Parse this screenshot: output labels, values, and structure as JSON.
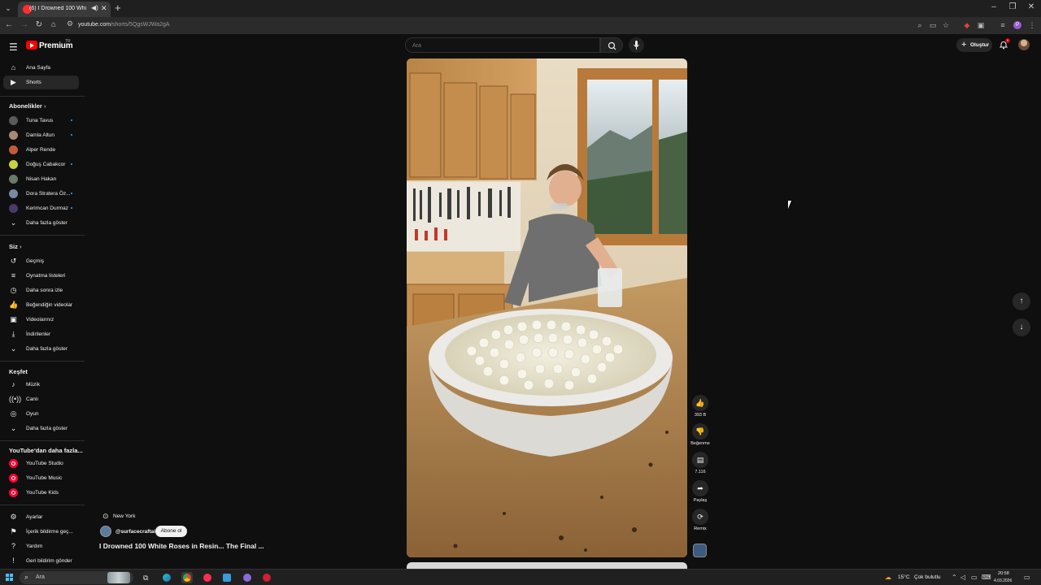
{
  "browser": {
    "tab_title": "(6) I Drowned 100 White R",
    "tab_audio_icon": "speaker-icon",
    "url_host": "youtube.com",
    "url_path": "/shorts/5QgsWJWa2gA",
    "profile_letter": "P"
  },
  "header": {
    "brand": "Premium",
    "brand_region": "TR",
    "search_placeholder": "Ara",
    "create_label": "Oluştur",
    "notification_count": "9"
  },
  "sidebar": {
    "main": [
      {
        "label": "Ana Sayfa",
        "icon": "home-icon"
      },
      {
        "label": "Shorts",
        "icon": "shorts-icon"
      }
    ],
    "subscriptions_title": "Abonelikler",
    "subscriptions": [
      {
        "label": "Tuna Tavus",
        "dot": true,
        "color": "#5a5a5a"
      },
      {
        "label": "Damla Altun",
        "dot": true,
        "color": "#a88a70"
      },
      {
        "label": "Alper Rende",
        "dot": false,
        "color": "#c45a3a"
      },
      {
        "label": "Doğuş Cabakcor",
        "dot": true,
        "color": "#c8d240"
      },
      {
        "label": "Nisan Hakan",
        "dot": false,
        "color": "#6a7a6a"
      },
      {
        "label": "Dora Stratera Öz...",
        "dot": true,
        "color": "#7a8aa0"
      },
      {
        "label": "Kerimcan Durmaz",
        "dot": true,
        "color": "#4a3a6a"
      }
    ],
    "show_more": "Daha fazla göster",
    "you_title": "Siz",
    "you": [
      {
        "label": "Geçmiş",
        "icon": "history-icon"
      },
      {
        "label": "Oynatma listeleri",
        "icon": "playlists-icon"
      },
      {
        "label": "Daha sonra izle",
        "icon": "clock-icon"
      },
      {
        "label": "Beğendiğin videolar",
        "icon": "thumbs-up-icon"
      },
      {
        "label": "Videolarınız",
        "icon": "your-videos-icon"
      },
      {
        "label": "İndirilenler",
        "icon": "download-icon"
      }
    ],
    "explore_title": "Keşfet",
    "explore": [
      {
        "label": "Müzik",
        "icon": "music-icon"
      },
      {
        "label": "Canlı",
        "icon": "live-icon"
      },
      {
        "label": "Oyun",
        "icon": "gaming-icon"
      }
    ],
    "more_title": "YouTube'dan daha fazla...",
    "more": [
      {
        "label": "YouTube Studio"
      },
      {
        "label": "YouTube Music"
      },
      {
        "label": "YouTube Kids"
      }
    ],
    "footer": [
      {
        "label": "Ayarlar",
        "icon": "settings-icon"
      },
      {
        "label": "İçerik bildirme geç...",
        "icon": "flag-icon"
      },
      {
        "label": "Yardım",
        "icon": "help-icon"
      },
      {
        "label": "Geri bildirim gönder",
        "icon": "feedback-icon"
      }
    ]
  },
  "video": {
    "location": "New York",
    "channel": "@surfacecraftai",
    "subscribe_label": "Abone ol",
    "title": "I Drowned 100 White Roses in Resin... The Final ..."
  },
  "actions": {
    "likes": "393 B",
    "dislike_label": "Beğenme",
    "comments": "7.116",
    "share_label": "Paylaş",
    "remix_label": "Remix"
  },
  "taskbar": {
    "search_placeholder": "Ara",
    "weather": "15°C",
    "weather_desc": "Çok bulutlu",
    "time": "20:58",
    "date": "4.03.2026"
  },
  "colors": {
    "background": "#0f0f0f",
    "accent_red": "#ff0000",
    "subscribe_bg": "#f1f1f1"
  }
}
